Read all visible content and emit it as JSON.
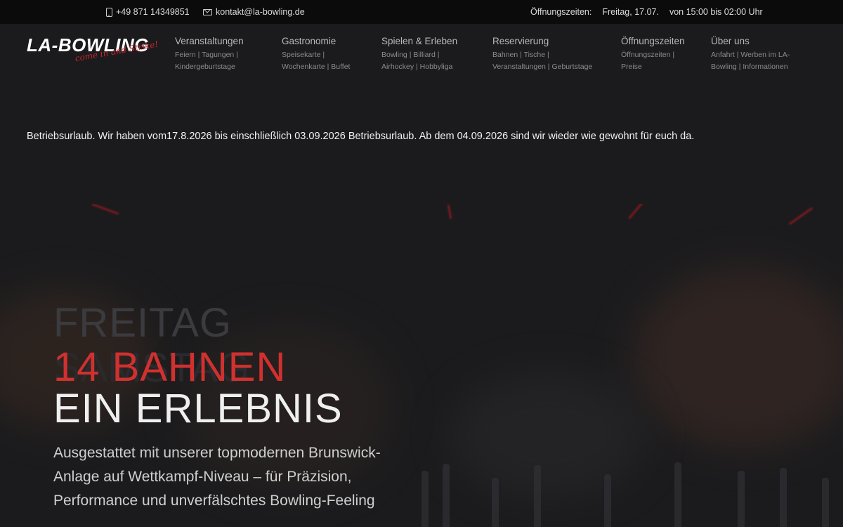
{
  "topbar": {
    "phone": "+49 871 14349851",
    "email": "kontakt@la-bowling.de",
    "hours_label": "Öffnungszeiten:",
    "hours_day": "Freitag, 17.07.",
    "hours_time": "von 15:00 bis 02:00 Uhr"
  },
  "logo": {
    "word": "LA-BOWLING",
    "tagline": "come in and Strike!"
  },
  "nav": [
    {
      "label": "Veranstaltungen",
      "sub": "Feiern | Tagungen | Kindergeburtstage"
    },
    {
      "label": "Gastronomie",
      "sub": "Speisekarte | Wochenkarte | Buffet"
    },
    {
      "label": "Spielen & Erleben",
      "sub": "Bowling | Billiard | Airhockey | Hobbyliga"
    },
    {
      "label": "Reservierung",
      "sub": "Bahnen | Tische | Veranstaltungen | Geburtstage"
    },
    {
      "label": "Öffnungszeiten",
      "sub": "Öffnungszeiten | Preise"
    },
    {
      "label": "Über uns",
      "sub": "Anfahrt | Werben im LA-Bowling | Informationen"
    }
  ],
  "notice": "Betriebsurlaub.  Wir haben vom17.8.2026 bis einschließlich 03.09.2026 Betriebsurlaub. Ab dem 04.09.2026 sind wir wieder wie gewohnt für euch da.",
  "hero": {
    "ghost_line1": "FREITAG",
    "ghost_line2": "SAMSTAG",
    "title_line1": "14 BAHNEN",
    "title_line2": "EIN ERLEBNIS",
    "description": "Ausgestattet mit unserer topmodernen Brunswick-Anlage auf Wettkampf-Niveau – für Präzision, Performance und unverfälschtes Bowling-Feeling"
  },
  "colors": {
    "accent_red": "#d0312f",
    "background": "#1b1b1d",
    "topbar": "#0b0b0c"
  }
}
